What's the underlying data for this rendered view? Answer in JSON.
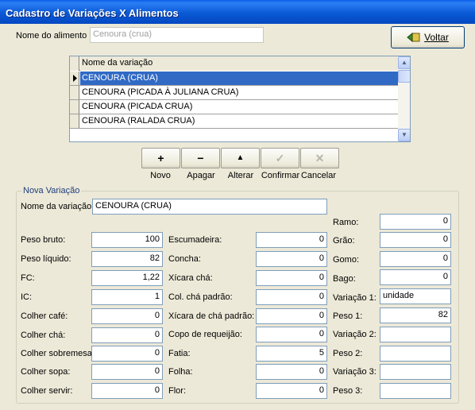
{
  "window": {
    "title": "Cadastro de Variações X Alimentos"
  },
  "food": {
    "label": "Nome do alimento :",
    "value": "Cenoura (crua)"
  },
  "back_button": {
    "label": "Voltar"
  },
  "grid": {
    "header": "Nome da variação",
    "rows": [
      {
        "name": "CENOURA (CRUA)",
        "selected": true
      },
      {
        "name": "CENOURA (PICADA À JULIANA CRUA)"
      },
      {
        "name": "CENOURA (PICADA CRUA)"
      },
      {
        "name": "CENOURA (RALADA CRUA)"
      }
    ]
  },
  "toolbar": {
    "novo": {
      "icon": "plus-icon",
      "glyph": "+",
      "label": "Novo"
    },
    "apagar": {
      "icon": "minus-icon",
      "glyph": "−",
      "label": "Apagar"
    },
    "alterar": {
      "icon": "up-arrow-icon",
      "glyph": "▲",
      "label": "Alterar"
    },
    "confirmar": {
      "icon": "check-icon",
      "glyph": "✓",
      "label": "Confirmar"
    },
    "cancelar": {
      "icon": "x-icon",
      "glyph": "✕",
      "label": "Cancelar"
    }
  },
  "variation": {
    "group_title": "Nova Variação",
    "name_label": "Nome da variação:",
    "name_value": "CENOURA (CRUA)",
    "col1": [
      {
        "label": "Peso bruto:",
        "value": "100"
      },
      {
        "label": "Peso líquido:",
        "value": "82"
      },
      {
        "label": "FC:",
        "value": "1,22"
      },
      {
        "label": "IC:",
        "value": "1"
      },
      {
        "label": "Colher café:",
        "value": "0"
      },
      {
        "label": "Colher chá:",
        "value": "0"
      },
      {
        "label": "Colher sobremesa:",
        "value": "0"
      },
      {
        "label": "Colher sopa:",
        "value": "0"
      },
      {
        "label": "Colher servir:",
        "value": "0"
      }
    ],
    "col2": [
      {
        "label": "Escumadeira:",
        "value": "0"
      },
      {
        "label": "Concha:",
        "value": "0"
      },
      {
        "label": "Xícara chá:",
        "value": "0"
      },
      {
        "label": "Col. chá padrão:",
        "value": "0"
      },
      {
        "label": "Xícara de chá padrão:",
        "value": "0"
      },
      {
        "label": "Copo de requeijão:",
        "value": "0"
      },
      {
        "label": "Fatia:",
        "value": "5"
      },
      {
        "label": "Folha:",
        "value": "0"
      },
      {
        "label": "Flor:",
        "value": "0"
      }
    ],
    "col3": [
      {
        "label": "Ramo:",
        "value": "0"
      },
      {
        "label": "Grão:",
        "value": "0"
      },
      {
        "label": "Gomo:",
        "value": "0"
      },
      {
        "label": "Bago:",
        "value": "0"
      },
      {
        "label": "Variação 1:",
        "value": "unidade"
      },
      {
        "label": "Peso 1:",
        "value": "82"
      },
      {
        "label": "Variação 2:",
        "value": ""
      },
      {
        "label": "Peso 2:",
        "value": ""
      },
      {
        "label": "Variação 3:",
        "value": ""
      },
      {
        "label": "Peso 3:",
        "value": ""
      }
    ]
  }
}
